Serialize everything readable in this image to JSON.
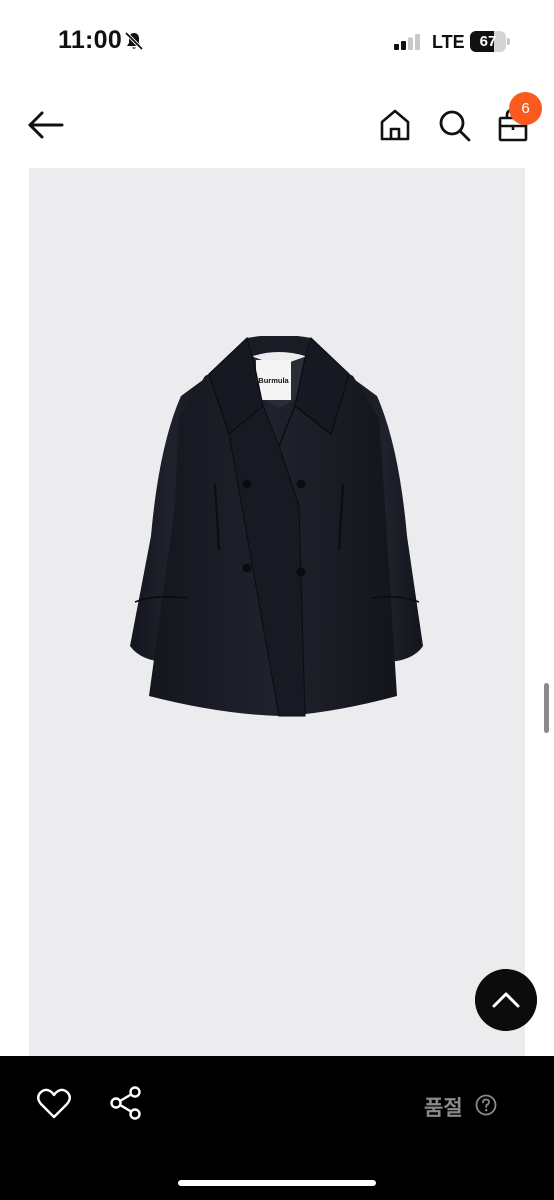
{
  "status_bar": {
    "time": "11:00",
    "network": "LTE",
    "battery_percent": "67",
    "battery_level": 0.67
  },
  "nav": {
    "back_icon": "arrow-left-icon",
    "home_icon": "home-icon",
    "search_icon": "search-icon",
    "bag_icon": "shopping-bag-icon",
    "cart_count": "6",
    "badge_color": "#fa5a1e"
  },
  "product": {
    "brand_label": "Burmula",
    "image_background": "#ececee",
    "coat_color": "#1b1d26"
  },
  "scroll_top": {
    "icon": "chevron-up-icon"
  },
  "bottom_bar": {
    "wishlist_icon": "heart-icon",
    "share_icon": "share-icon",
    "status_label": "품절",
    "help_icon": "question-circle-icon"
  }
}
